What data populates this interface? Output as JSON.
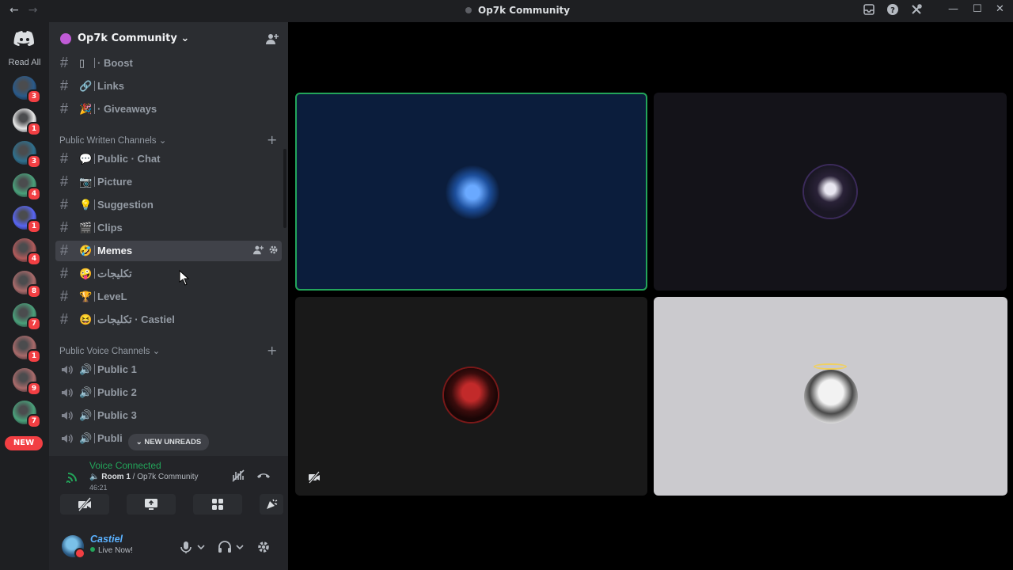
{
  "window": {
    "title": "Op7k Community",
    "back": "←",
    "forward": "→",
    "minimize": "—",
    "maximize": "☐",
    "close": "✕"
  },
  "rail": {
    "read_all": "Read All",
    "servers": [
      {
        "badge": "3",
        "color": "#2a5a8a"
      },
      {
        "badge": "1",
        "color": "#e6e6e6"
      },
      {
        "badge": "3",
        "color": "#2f6f8c"
      },
      {
        "badge": "4",
        "color": "#4aa07a"
      },
      {
        "badge": "1",
        "color": "#5865f2"
      },
      {
        "badge": "4",
        "color": "#b05a5a"
      },
      {
        "badge": "8",
        "color": "#a86a6a"
      },
      {
        "badge": "7",
        "color": "#4aa07a"
      },
      {
        "badge": "1",
        "color": "#a86a6a"
      },
      {
        "badge": "9",
        "color": "#a86a6a"
      },
      {
        "badge": "7",
        "color": "#4aa07a"
      }
    ],
    "new_label": "NEW"
  },
  "server": {
    "name": "Op7k Community",
    "chevron": "⌄"
  },
  "channels_top": [
    {
      "emoji": "▯",
      "label": "· Boost"
    },
    {
      "emoji": "🔗",
      "label": "Links"
    },
    {
      "emoji": "🎉",
      "label": "· Giveaways"
    }
  ],
  "categories": {
    "written": "Public Written Channels ⌄",
    "voice": "Public Voice Channels ⌄",
    "plus": "+"
  },
  "written_channels": [
    {
      "emoji": "💬",
      "label": "Public · Chat"
    },
    {
      "emoji": "📷",
      "label": "Picture"
    },
    {
      "emoji": "💡",
      "label": "Suggestion"
    },
    {
      "emoji": "🎬",
      "label": "Clips"
    },
    {
      "emoji": "🤣",
      "label": "Memes",
      "active": true
    },
    {
      "emoji": "🤪",
      "label": "تكليجات"
    },
    {
      "emoji": "🏆",
      "label": "LeveL"
    },
    {
      "emoji": "😆",
      "label": "تكليجات · Castiel"
    }
  ],
  "voice_channels": [
    {
      "emoji": "🔊",
      "label": "Public 1"
    },
    {
      "emoji": "🔊",
      "label": "Public 2"
    },
    {
      "emoji": "🔊",
      "label": "Public 3"
    },
    {
      "emoji": "🔊",
      "label": "Publi"
    }
  ],
  "new_unreads": "⌄  NEW UNREADS",
  "voice_panel": {
    "status": "Voice Connected",
    "room": "Room 1",
    "server": "Op7k Community",
    "elapsed": "46:21"
  },
  "user": {
    "name": "Castiel",
    "status": "Live Now!"
  },
  "colors": {
    "accent_green": "#23a55a",
    "accent_red": "#f23f43",
    "blurple": "#5865f2"
  }
}
